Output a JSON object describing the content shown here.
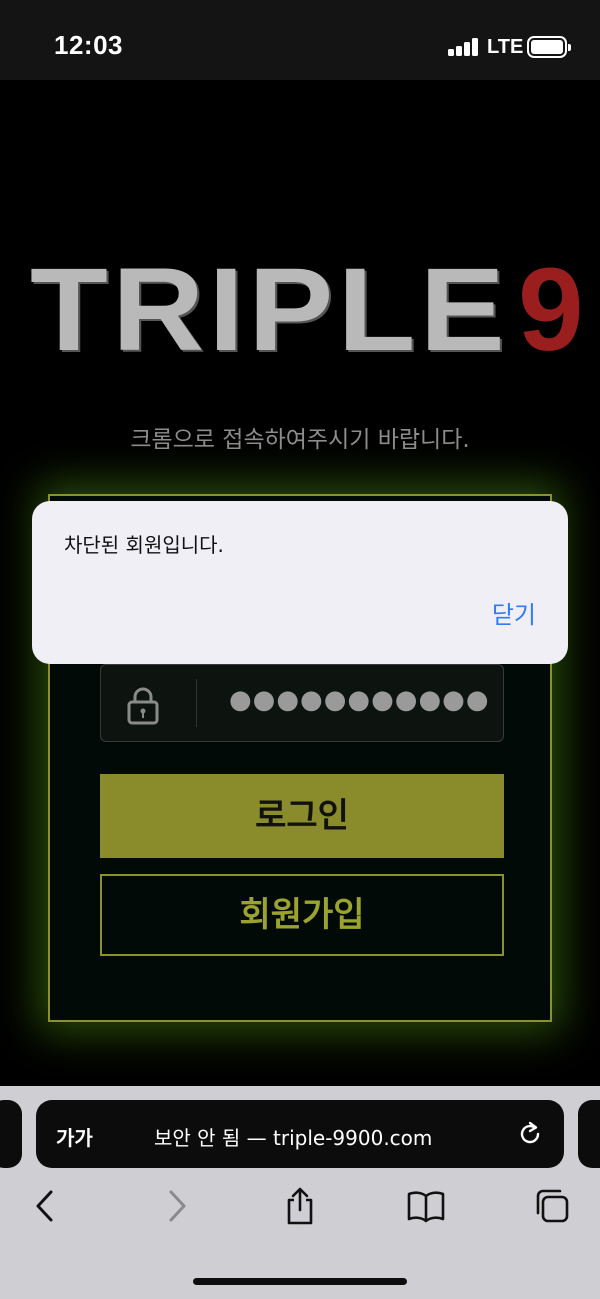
{
  "status_bar": {
    "time": "12:03",
    "network": "LTE"
  },
  "page": {
    "logo_text": "TRIPLE",
    "logo_number": "9",
    "notice": "크롬으로 접속하여주시기 바랍니다.",
    "password_mask": "●●●●●●●●●●●",
    "login_label": "로그인",
    "signup_label": "회원가입",
    "accent_color": "#8a8c2c",
    "logo_red": "#9b1e1e"
  },
  "alert": {
    "message": "차단된 회원입니다.",
    "close_label": "닫기"
  },
  "browser": {
    "text_size_label": "가가",
    "address": "보안 안 됨 — triple-9900.com"
  }
}
